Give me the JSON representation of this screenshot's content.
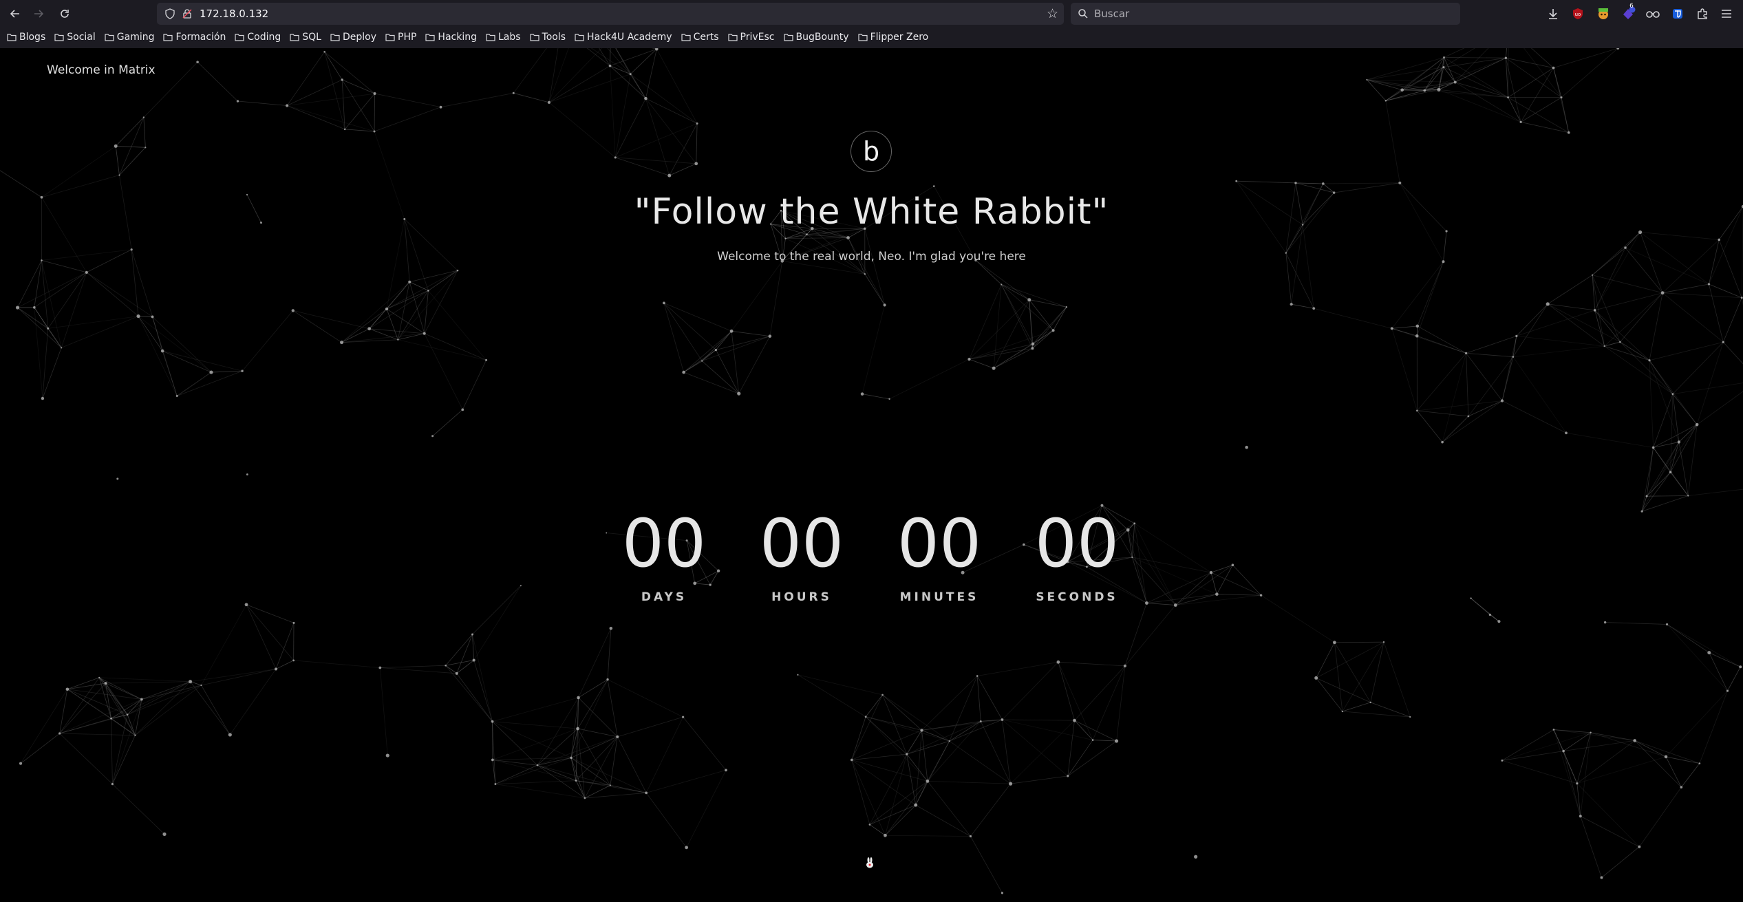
{
  "browser": {
    "url": "172.18.0.132",
    "search_placeholder": "Buscar",
    "bookmarks": [
      "Blogs",
      "Social",
      "Gaming",
      "Formación",
      "Coding",
      "SQL",
      "Deploy",
      "PHP",
      "Hacking",
      "Labs",
      "Tools",
      "Hack4U Academy",
      "Certs",
      "PrivEsc",
      "BugBounty",
      "Flipper Zero"
    ],
    "extension_badge": "6"
  },
  "page": {
    "site_title": "Welcome in Matrix",
    "logo_letter": "b",
    "headline": "\"Follow the White Rabbit\"",
    "subtitle": "Welcome to the real world, Neo. I'm glad you're here",
    "countdown": [
      {
        "value": "00",
        "label": "DAYS"
      },
      {
        "value": "00",
        "label": "HOURS"
      },
      {
        "value": "00",
        "label": "MINUTES"
      },
      {
        "value": "00",
        "label": "SECONDS"
      }
    ]
  }
}
